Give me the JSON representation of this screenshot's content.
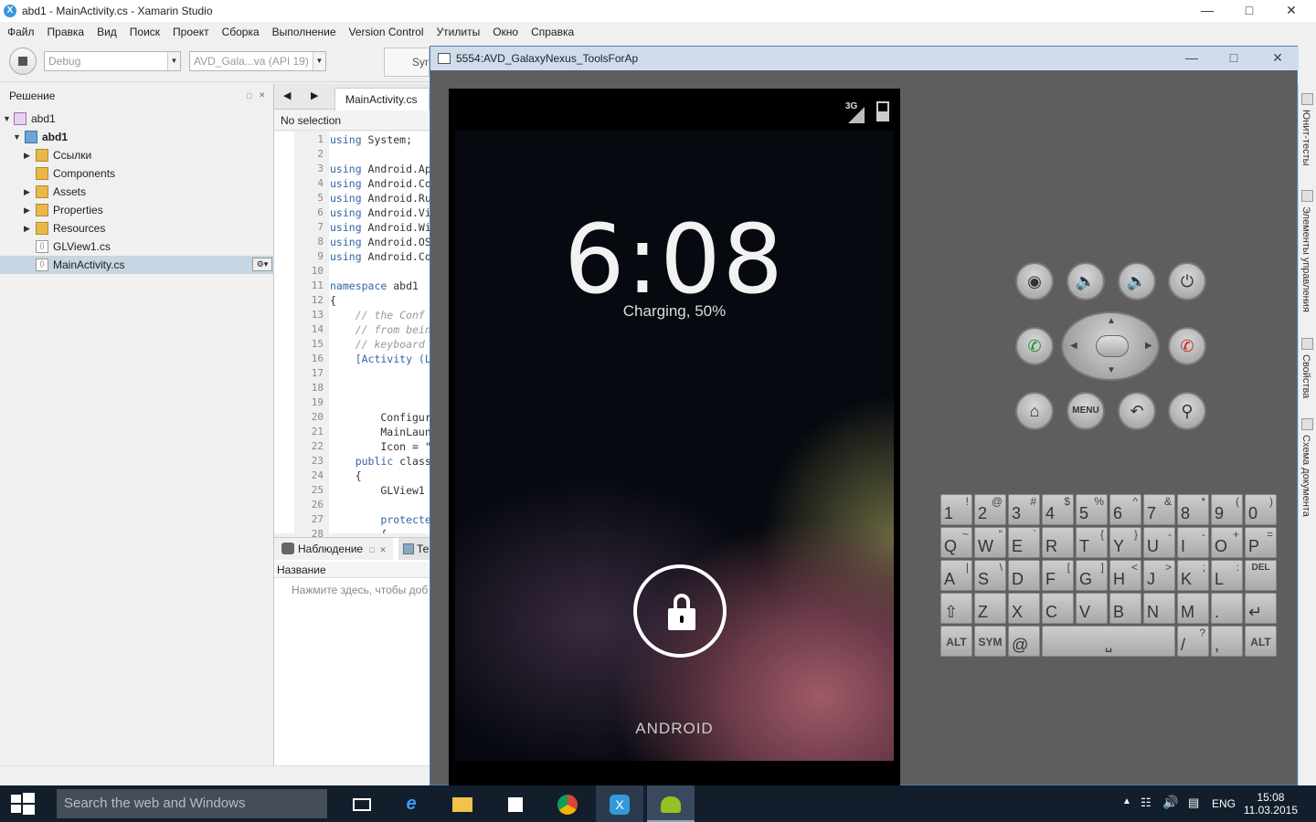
{
  "window": {
    "title": "abd1 - MainActivity.cs - Xamarin Studio",
    "app_icon": "X"
  },
  "menu": [
    "Файл",
    "Правка",
    "Вид",
    "Поиск",
    "Проект",
    "Сборка",
    "Выполнение",
    "Version Control",
    "Утилиты",
    "Окно",
    "Справка"
  ],
  "toolbar": {
    "config": "Debug",
    "device": "AVD_Gala...va (API 19)",
    "sync_label": "Syn"
  },
  "solution": {
    "title": "Решение",
    "items": [
      {
        "label": "abd1",
        "type": "solution"
      },
      {
        "label": "abd1",
        "type": "project"
      },
      {
        "label": "Ссылки",
        "type": "folder"
      },
      {
        "label": "Components",
        "type": "folder"
      },
      {
        "label": "Assets",
        "type": "folder"
      },
      {
        "label": "Properties",
        "type": "folder"
      },
      {
        "label": "Resources",
        "type": "folder"
      },
      {
        "label": "GLView1.cs",
        "type": "file"
      },
      {
        "label": "MainActivity.cs",
        "type": "file",
        "selected": true
      }
    ]
  },
  "editor": {
    "tab": "MainActivity.cs",
    "selection": "No selection",
    "lines": [
      {
        "n": "1",
        "t": "using System;"
      },
      {
        "n": "2",
        "t": ""
      },
      {
        "n": "3",
        "t": "using Android.Ap"
      },
      {
        "n": "4",
        "t": "using Android.Co"
      },
      {
        "n": "5",
        "t": "using Android.Ru"
      },
      {
        "n": "6",
        "t": "using Android.Vi"
      },
      {
        "n": "7",
        "t": "using Android.Wi"
      },
      {
        "n": "8",
        "t": "using Android.OS"
      },
      {
        "n": "9",
        "t": "using Android.Co"
      },
      {
        "n": "10",
        "t": ""
      },
      {
        "n": "11",
        "t": "namespace abd1"
      },
      {
        "n": "12",
        "t": "{"
      },
      {
        "n": "13",
        "t": "    // the Conf"
      },
      {
        "n": "14",
        "t": "    // from bein"
      },
      {
        "n": "15",
        "t": "    // keyboard"
      },
      {
        "n": "16",
        "t": "    [Activity (L"
      },
      {
        "n": "17",
        "t": ""
      },
      {
        "n": "18",
        "t": ""
      },
      {
        "n": "19",
        "t": ""
      },
      {
        "n": "20",
        "t": "        Configur"
      },
      {
        "n": "21",
        "t": "        MainLaun"
      },
      {
        "n": "22",
        "t": "        Icon = \""
      },
      {
        "n": "23",
        "t": "    public class"
      },
      {
        "n": "24",
        "t": "    {"
      },
      {
        "n": "25",
        "t": "        GLView1"
      },
      {
        "n": "26",
        "t": ""
      },
      {
        "n": "27",
        "t": "        protecte"
      },
      {
        "n": "28",
        "t": "        {"
      }
    ]
  },
  "watch": {
    "tab": "Наблюдение",
    "tab2": "Те",
    "column": "Название",
    "hint": "Нажмите здесь, чтобы доб"
  },
  "side_strip": [
    "Юнит-тесты",
    "Элементы управления",
    "Свойства",
    "Схема документа"
  ],
  "emulator": {
    "title": "5554:AVD_GalaxyNexus_ToolsForAp",
    "network": "3G",
    "clock": "6:08",
    "charging": "Charging, 50%",
    "carrier": "ANDROID",
    "buttons": [
      "camera-icon",
      "volume-down-icon",
      "volume-up-icon",
      "power-icon",
      "call-icon",
      "end-call-icon",
      "home-icon",
      "MENU",
      "back-icon",
      "search-icon"
    ],
    "keys": [
      [
        [
          "1",
          "!"
        ],
        [
          "2",
          "@"
        ],
        [
          "3",
          "#"
        ],
        [
          "4",
          "$"
        ],
        [
          "5",
          "%"
        ],
        [
          "6",
          "^"
        ],
        [
          "7",
          "&"
        ],
        [
          "8",
          "*"
        ],
        [
          "9",
          "("
        ],
        [
          "0",
          ")"
        ]
      ],
      [
        [
          "Q",
          "~"
        ],
        [
          "W",
          "\""
        ],
        [
          "E",
          "`"
        ],
        [
          "R",
          ""
        ],
        [
          "T",
          "{"
        ],
        [
          "Y",
          "}"
        ],
        [
          "U",
          "-"
        ],
        [
          "I",
          "-"
        ],
        [
          "O",
          "+"
        ],
        [
          "P",
          "="
        ]
      ],
      [
        [
          "A",
          "|"
        ],
        [
          "S",
          "\\"
        ],
        [
          "D",
          ""
        ],
        [
          "F",
          "["
        ],
        [
          "G",
          "]"
        ],
        [
          "H",
          "<"
        ],
        [
          "J",
          ">"
        ],
        [
          "K",
          ";"
        ],
        [
          "L",
          ":"
        ],
        [
          "DEL",
          ""
        ]
      ],
      [
        [
          "⇧",
          ""
        ],
        [
          "Z",
          ""
        ],
        [
          "X",
          ""
        ],
        [
          "C",
          ""
        ],
        [
          "V",
          ""
        ],
        [
          "B",
          ""
        ],
        [
          "N",
          ""
        ],
        [
          "M",
          ""
        ],
        [
          ".",
          ""
        ],
        [
          "↵",
          ""
        ]
      ],
      [
        [
          "ALT",
          ""
        ],
        [
          "SYM",
          ""
        ],
        [
          "@",
          ""
        ],
        [
          "",
          ""
        ],
        [
          "/",
          "?"
        ],
        [
          ",",
          ""
        ],
        [
          "ALT",
          ""
        ]
      ]
    ]
  },
  "taskbar": {
    "search_placeholder": "Search the web and Windows",
    "lang": "ENG",
    "time": "15:08",
    "date": "11.03.2015"
  }
}
